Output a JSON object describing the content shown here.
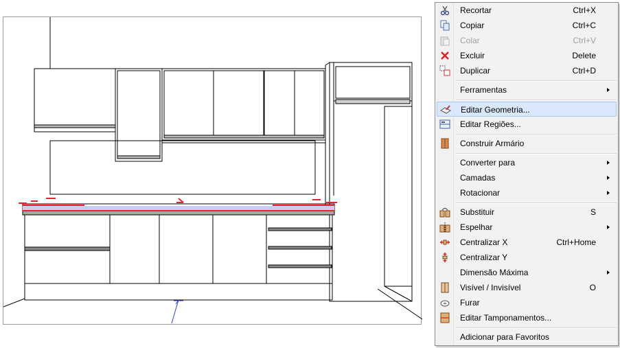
{
  "menu": {
    "items": [
      {
        "label": "Recortar",
        "shortcut": "Ctrl+X",
        "icon": "scissors-icon",
        "enabled": true
      },
      {
        "label": "Copiar",
        "shortcut": "Ctrl+C",
        "icon": "copy-icon",
        "enabled": true
      },
      {
        "label": "Colar",
        "shortcut": "Ctrl+V",
        "icon": "paste-icon",
        "enabled": false
      },
      {
        "label": "Excluir",
        "shortcut": "Delete",
        "icon": "delete-x-icon",
        "enabled": true
      },
      {
        "label": "Duplicar",
        "shortcut": "Ctrl+D",
        "icon": "duplicate-icon",
        "enabled": true
      },
      {
        "label": "Ferramentas",
        "shortcut": "",
        "icon": "",
        "submenu": true,
        "enabled": true
      },
      {
        "label": "Editar Geometria...",
        "shortcut": "",
        "icon": "edit-geometry-icon",
        "highlighted": true,
        "enabled": true
      },
      {
        "label": "Editar Regiões...",
        "shortcut": "",
        "icon": "edit-regions-icon",
        "enabled": true
      },
      {
        "label": "Construir Armário",
        "shortcut": "",
        "icon": "build-cabinet-icon",
        "enabled": true
      },
      {
        "label": "Converter para",
        "shortcut": "",
        "icon": "",
        "submenu": true,
        "enabled": true
      },
      {
        "label": "Camadas",
        "shortcut": "",
        "icon": "",
        "submenu": true,
        "enabled": true
      },
      {
        "label": "Rotacionar",
        "shortcut": "",
        "icon": "",
        "submenu": true,
        "enabled": true
      },
      {
        "label": "Substituir",
        "shortcut": "S",
        "icon": "replace-icon",
        "enabled": true
      },
      {
        "label": "Espelhar",
        "shortcut": "",
        "icon": "mirror-icon",
        "submenu": true,
        "enabled": true
      },
      {
        "label": "Centralizar X",
        "shortcut": "Ctrl+Home",
        "icon": "center-x-icon",
        "enabled": true
      },
      {
        "label": "Centralizar Y",
        "shortcut": "",
        "icon": "center-y-icon",
        "enabled": true
      },
      {
        "label": "Dimensão Máxima",
        "shortcut": "",
        "icon": "",
        "submenu": true,
        "enabled": true
      },
      {
        "label": "Visível / Invisível",
        "shortcut": "O",
        "icon": "visibility-icon",
        "enabled": true
      },
      {
        "label": "Furar",
        "shortcut": "",
        "icon": "drill-icon",
        "enabled": true
      },
      {
        "label": "Editar Tamponamentos...",
        "shortcut": "",
        "icon": "edit-covers-icon",
        "enabled": true
      },
      {
        "label": "Adicionar para Favoritos",
        "shortcut": "",
        "icon": "",
        "enabled": true
      }
    ]
  },
  "colors": {
    "highlight_bg": "#d9e8fb",
    "highlight_border": "#a8c8ee",
    "countertop_edge": "#e8232c",
    "countertop_selection": "#c9cdf2",
    "axis_arrow": "#2a3fd8"
  }
}
